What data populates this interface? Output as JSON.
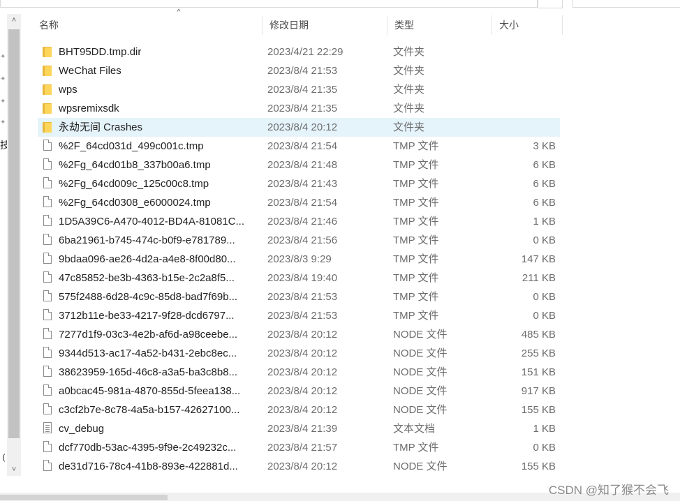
{
  "columns": {
    "name": "名称",
    "date": "修改日期",
    "type": "类型",
    "size": "大小"
  },
  "left_edge": {
    "char1": "技",
    "char2": ") ("
  },
  "rows": [
    {
      "name": "BHT95DD.tmp.dir",
      "date": "2023/4/21 22:29",
      "type": "文件夹",
      "size": "",
      "icon": "folder-icon"
    },
    {
      "name": "WeChat Files",
      "date": "2023/8/4 21:53",
      "type": "文件夹",
      "size": "",
      "icon": "folder-icon"
    },
    {
      "name": "wps",
      "date": "2023/8/4 21:35",
      "type": "文件夹",
      "size": "",
      "icon": "folder-icon"
    },
    {
      "name": "wpsremixsdk",
      "date": "2023/8/4 21:35",
      "type": "文件夹",
      "size": "",
      "icon": "folder-icon"
    },
    {
      "name": "永劫无间 Crashes",
      "date": "2023/8/4 20:12",
      "type": "文件夹",
      "size": "",
      "icon": "folder-icon",
      "selected": true
    },
    {
      "name": "%2F_64cd031d_499c001c.tmp",
      "date": "2023/8/4 21:54",
      "type": "TMP 文件",
      "size": "3 KB",
      "icon": "file-icon"
    },
    {
      "name": "%2Fg_64cd01b8_337b00a6.tmp",
      "date": "2023/8/4 21:48",
      "type": "TMP 文件",
      "size": "6 KB",
      "icon": "file-icon"
    },
    {
      "name": "%2Fg_64cd009c_125c00c8.tmp",
      "date": "2023/8/4 21:43",
      "type": "TMP 文件",
      "size": "6 KB",
      "icon": "file-icon"
    },
    {
      "name": "%2Fg_64cd0308_e6000024.tmp",
      "date": "2023/8/4 21:54",
      "type": "TMP 文件",
      "size": "6 KB",
      "icon": "file-icon"
    },
    {
      "name": "1D5A39C6-A470-4012-BD4A-81081C...",
      "date": "2023/8/4 21:46",
      "type": "TMP 文件",
      "size": "1 KB",
      "icon": "file-icon"
    },
    {
      "name": "6ba21961-b745-474c-b0f9-e781789...",
      "date": "2023/8/4 21:56",
      "type": "TMP 文件",
      "size": "0 KB",
      "icon": "file-icon"
    },
    {
      "name": "9bdaa096-ae26-4d2a-a4e8-8f00d80...",
      "date": "2023/8/3 9:29",
      "type": "TMP 文件",
      "size": "147 KB",
      "icon": "file-icon"
    },
    {
      "name": "47c85852-be3b-4363-b15e-2c2a8f5...",
      "date": "2023/8/4 19:40",
      "type": "TMP 文件",
      "size": "211 KB",
      "icon": "file-icon"
    },
    {
      "name": "575f2488-6d28-4c9c-85d8-bad7f69b...",
      "date": "2023/8/4 21:53",
      "type": "TMP 文件",
      "size": "0 KB",
      "icon": "file-icon"
    },
    {
      "name": "3712b11e-be33-4217-9f28-dcd6797...",
      "date": "2023/8/4 21:53",
      "type": "TMP 文件",
      "size": "0 KB",
      "icon": "file-icon"
    },
    {
      "name": "7277d1f9-03c3-4e2b-af6d-a98ceebe...",
      "date": "2023/8/4 20:12",
      "type": "NODE 文件",
      "size": "485 KB",
      "icon": "file-icon"
    },
    {
      "name": "9344d513-ac17-4a52-b431-2ebc8ec...",
      "date": "2023/8/4 20:12",
      "type": "NODE 文件",
      "size": "255 KB",
      "icon": "file-icon"
    },
    {
      "name": "38623959-165d-46c8-a3a5-ba3c8b8...",
      "date": "2023/8/4 20:12",
      "type": "NODE 文件",
      "size": "151 KB",
      "icon": "file-icon"
    },
    {
      "name": "a0bcac45-981a-4870-855d-5feea138...",
      "date": "2023/8/4 20:12",
      "type": "NODE 文件",
      "size": "917 KB",
      "icon": "file-icon"
    },
    {
      "name": "c3cf2b7e-8c78-4a5a-b157-42627100...",
      "date": "2023/8/4 20:12",
      "type": "NODE 文件",
      "size": "155 KB",
      "icon": "file-icon"
    },
    {
      "name": "cv_debug",
      "date": "2023/8/4 21:39",
      "type": "文本文档",
      "size": "1 KB",
      "icon": "text-document-icon"
    },
    {
      "name": "dcf770db-53ac-4395-9f9e-2c49232c...",
      "date": "2023/8/4 21:57",
      "type": "TMP 文件",
      "size": "0 KB",
      "icon": "file-icon"
    },
    {
      "name": "de31d716-78c4-41b8-893e-422881d...",
      "date": "2023/8/4 20:12",
      "type": "NODE 文件",
      "size": "155 KB",
      "icon": "file-icon"
    }
  ],
  "watermark": "CSDN @知了猴不会飞"
}
